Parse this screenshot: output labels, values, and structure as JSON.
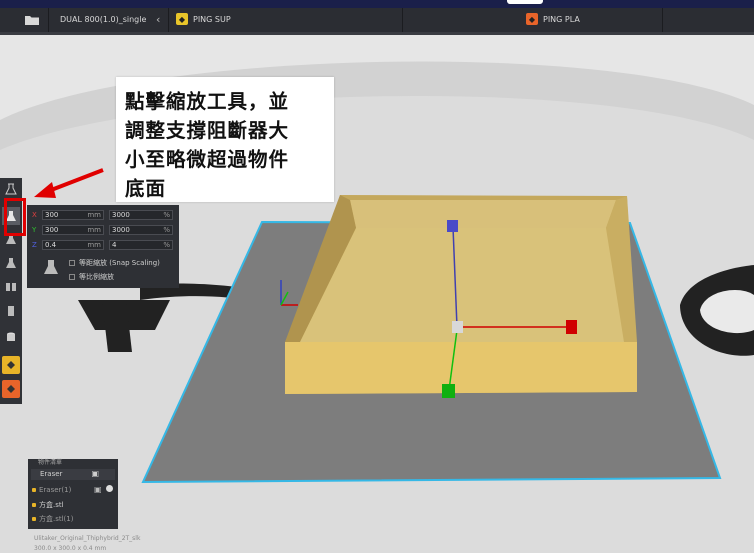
{
  "toolbar": {
    "machine_name": "DUAL 800(1.0)_single",
    "tab1_label": "PING SUP",
    "tab2_label": "PING PLA",
    "tab1_icon": "support-icon",
    "tab2_icon": "filament-icon",
    "tab1_color": "#e8c52a",
    "tab2_color": "#e8642a"
  },
  "callout": {
    "lines": [
      "點擊縮放工具，並",
      "調整支撐阻斷器大",
      "小至略微超過物件",
      "底面"
    ]
  },
  "scale_panel": {
    "x": {
      "axis": "X",
      "value": "300",
      "unit": "mm",
      "percent": "3000",
      "percent_unit": "%"
    },
    "y": {
      "axis": "Y",
      "value": "300",
      "unit": "mm",
      "percent": "3000",
      "percent_unit": "%"
    },
    "z": {
      "axis": "Z",
      "value": "0.4",
      "unit": "mm",
      "percent": "4",
      "percent_unit": "%"
    },
    "snap_label": "等距縮放 (Snap Scaling)",
    "uniform_label": "等比例縮放"
  },
  "object_list": {
    "header": "物件清單",
    "eraser_label": "Eraser",
    "items": [
      "Eraser(1)",
      "方盒.stl",
      "方盒.stl(1)"
    ]
  },
  "footnote": {
    "line1": "Ulitaker_Original_Thiphybrid_2T_slk",
    "line2": "300.0 x 300.0 x 0.4 mm"
  },
  "colors": {
    "accent_red": "#e00000",
    "box_fill": "#d9c27a",
    "plate_fill": "#7d7d7d",
    "plate_outline": "#35b8e6"
  }
}
